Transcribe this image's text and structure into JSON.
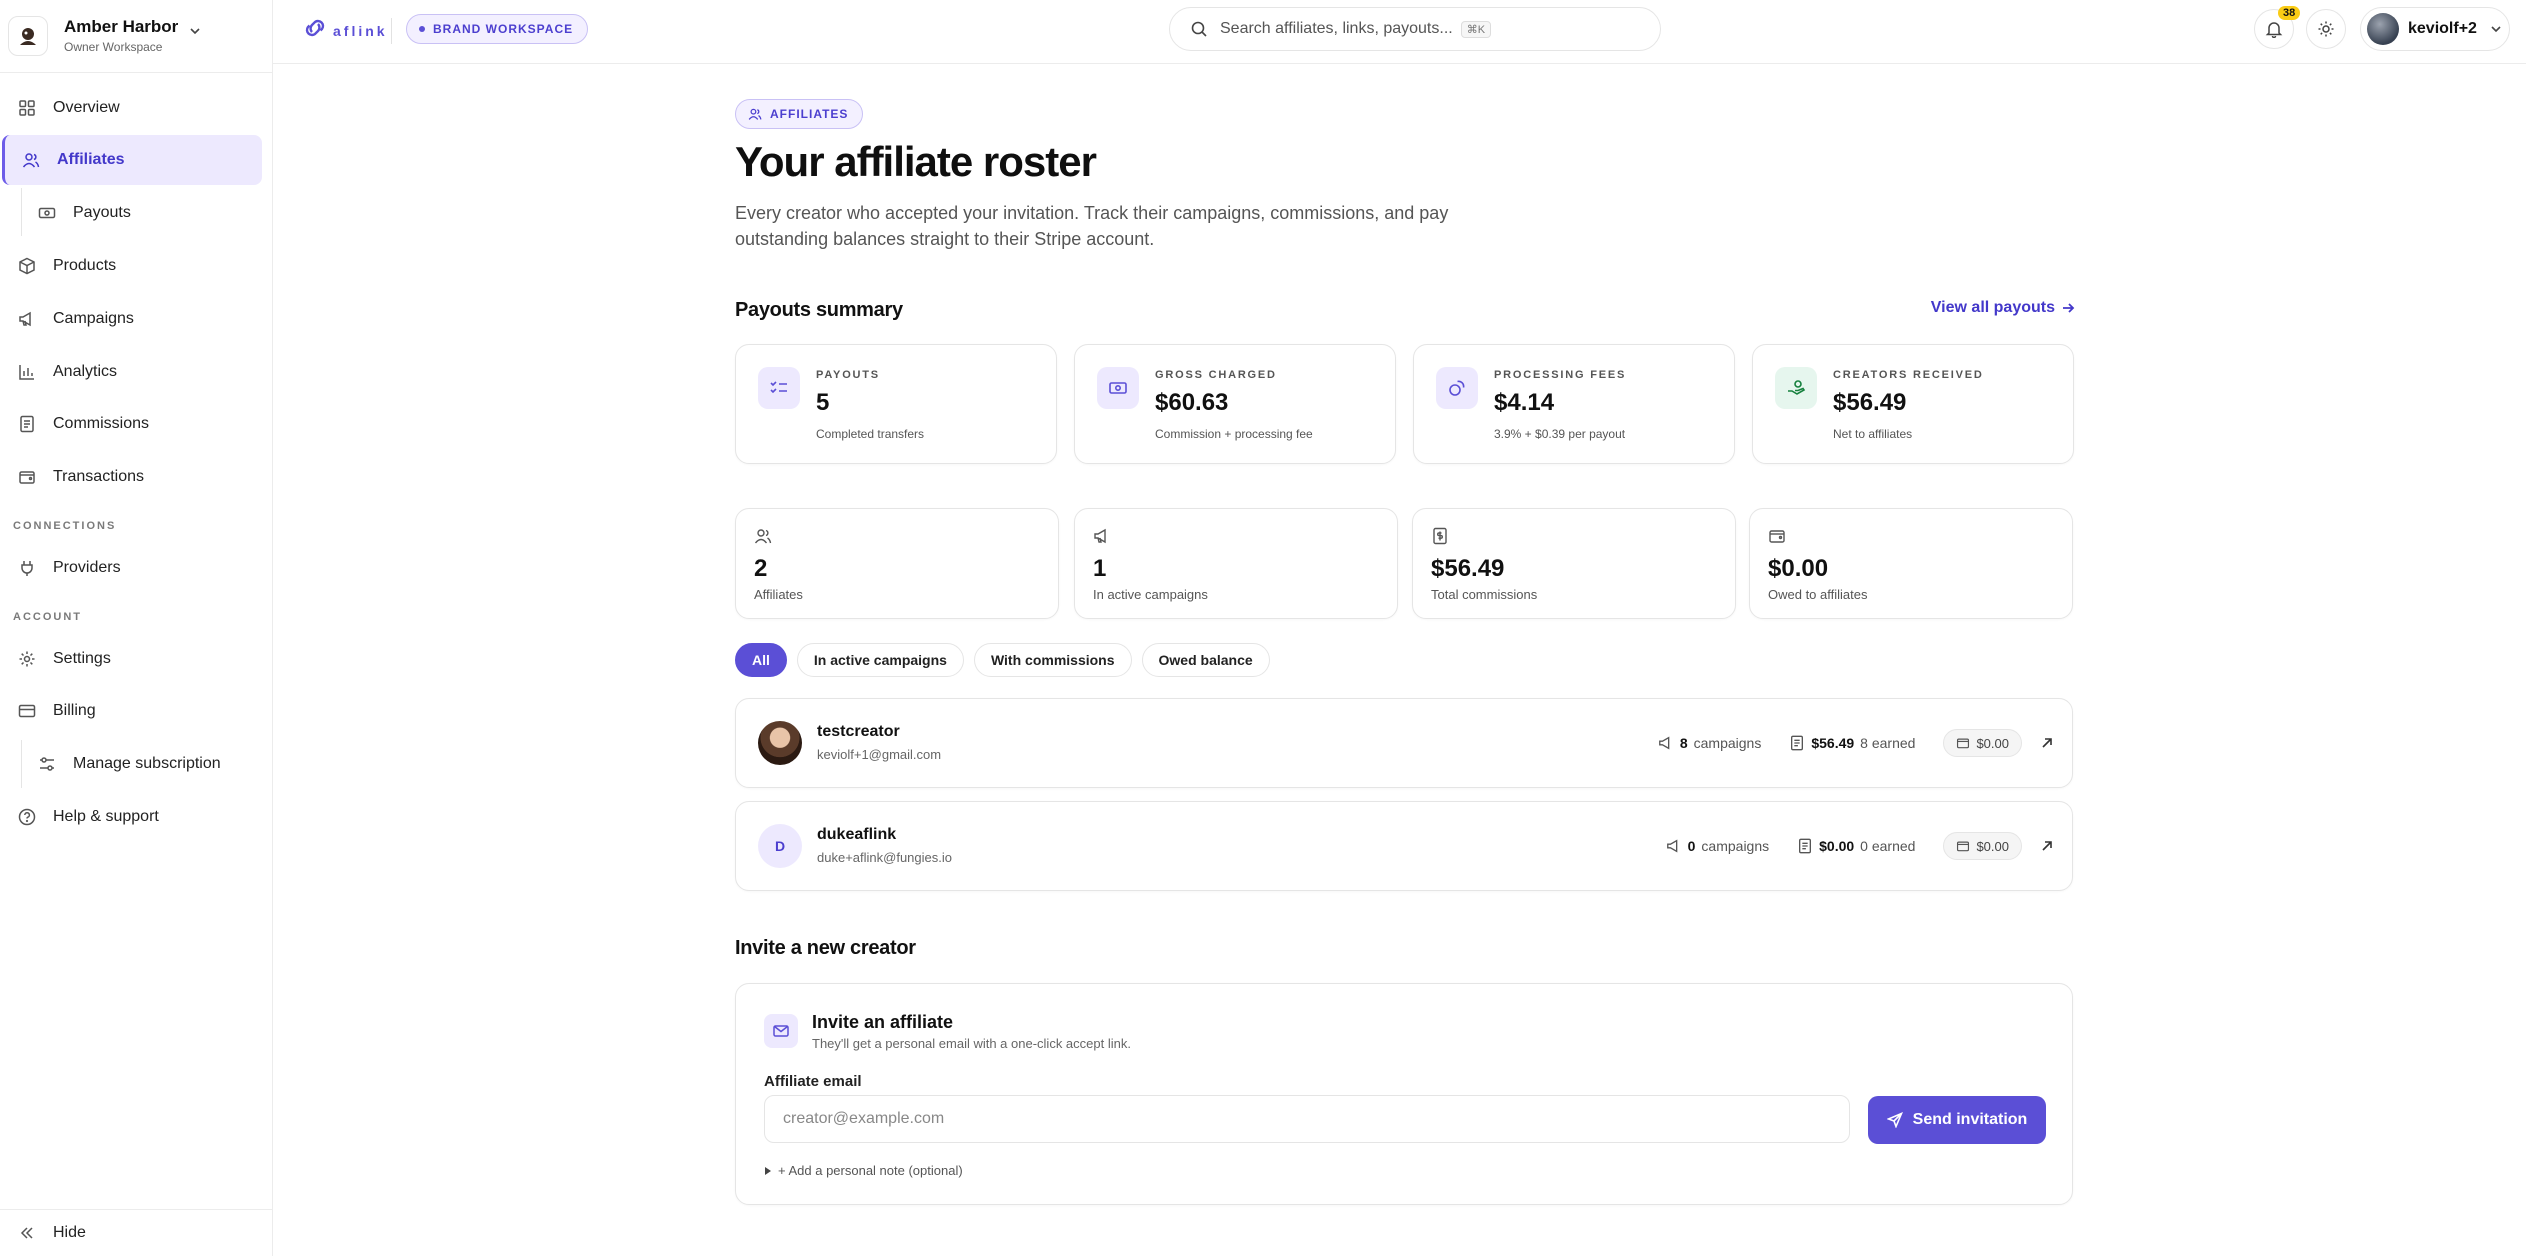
{
  "workspace": {
    "name": "Amber Harbor",
    "role": "Owner Workspace"
  },
  "sidebar": {
    "items": [
      {
        "label": "Overview"
      },
      {
        "label": "Affiliates"
      },
      {
        "label": "Payouts"
      },
      {
        "label": "Products"
      },
      {
        "label": "Campaigns"
      },
      {
        "label": "Analytics"
      },
      {
        "label": "Commissions"
      },
      {
        "label": "Transactions"
      }
    ],
    "connections_label": "CONNECTIONS",
    "providers": "Providers",
    "account_label": "ACCOUNT",
    "settings": "Settings",
    "billing": "Billing",
    "manage_subscription": "Manage subscription",
    "help": "Help & support",
    "hide": "Hide"
  },
  "topbar": {
    "brand": "aflink",
    "workspace_pill": "BRAND WORKSPACE",
    "search_placeholder": "Search affiliates, links, payouts...",
    "search_shortcut": "⌘K",
    "notifications_count": "38",
    "user": "keviolf+2"
  },
  "page": {
    "eyebrow": "AFFILIATES",
    "title": "Your affiliate roster",
    "description": "Every creator who accepted your invitation. Track their campaigns, commissions, and pay outstanding balances straight to their Stripe account."
  },
  "payouts_summary": {
    "title": "Payouts summary",
    "view_all": "View all payouts",
    "cards": [
      {
        "label": "PAYOUTS",
        "value": "5",
        "note": "Completed transfers"
      },
      {
        "label": "GROSS CHARGED",
        "value": "$60.63",
        "note": "Commission + processing fee"
      },
      {
        "label": "PROCESSING FEES",
        "value": "$4.14",
        "note": "3.9% + $0.39 per payout"
      },
      {
        "label": "CREATORS RECEIVED",
        "value": "$56.49",
        "note": "Net to affiliates"
      }
    ]
  },
  "stats": [
    {
      "value": "2",
      "label": "Affiliates"
    },
    {
      "value": "1",
      "label": "In active campaigns"
    },
    {
      "value": "$56.49",
      "label": "Total commissions"
    },
    {
      "value": "$0.00",
      "label": "Owed to affiliates"
    }
  ],
  "filters": [
    "All",
    "In active campaigns",
    "With commissions",
    "Owed balance"
  ],
  "affiliates": [
    {
      "name": "testcreator",
      "email": "keviolf+1@gmail.com",
      "campaigns": "8",
      "campaigns_label": "campaigns",
      "earned": "$56.49",
      "earned_label": "8 earned",
      "owed": "$0.00"
    },
    {
      "name": "dukeaflink",
      "email": "duke+aflink@fungies.io",
      "initial": "D",
      "campaigns": "0",
      "campaigns_label": "campaigns",
      "earned": "$0.00",
      "earned_label": "0 earned",
      "owed": "$0.00"
    }
  ],
  "invite": {
    "section_title": "Invite a new creator",
    "title": "Invite an affiliate",
    "subtitle": "They'll get a personal email with a one-click accept link.",
    "email_label": "Affiliate email",
    "email_placeholder": "creator@example.com",
    "send": "Send invitation",
    "note_toggle": "+ Add a personal note (optional)"
  },
  "colors": {
    "accent": "#5b4fd6",
    "accent_soft": "#ede9fe",
    "badge": "#facc15"
  }
}
